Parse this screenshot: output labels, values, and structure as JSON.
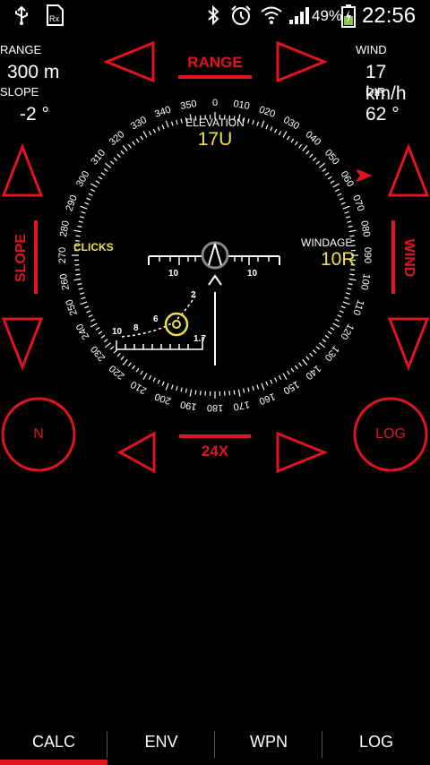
{
  "status_bar": {
    "battery": "49%",
    "time": "22:56"
  },
  "hud": {
    "range": {
      "label": "RANGE",
      "value": "300 m"
    },
    "slope": {
      "label": "SLOPE",
      "value": "-2 °"
    },
    "wind": {
      "label": "WIND",
      "value": "17 km/h"
    },
    "dir": {
      "label": "DIR",
      "value": "62 °"
    },
    "range_control": "RANGE",
    "slope_control": "SLOPE",
    "wind_control": "WIND",
    "zoom": "24X",
    "n_button": "N",
    "log_button": "LOG"
  },
  "scope": {
    "elevation_label": "ELEVATION",
    "elevation_value": "17U",
    "windage_label": "WINDAGE",
    "windage_value": "10R",
    "clicks_label": "CLICKS",
    "reticle_left_label": "10",
    "reticle_right_label": "10",
    "drop_labels": [
      "10",
      "8",
      "6",
      "2",
      "1.7"
    ]
  },
  "dial_labels": [
    "0",
    "010",
    "020",
    "030",
    "040",
    "050",
    "060",
    "070",
    "080",
    "090",
    "100",
    "110",
    "120",
    "130",
    "140",
    "150",
    "160",
    "170",
    "180",
    "190",
    "200",
    "210",
    "220",
    "230",
    "240",
    "250",
    "260",
    "270",
    "280",
    "290",
    "300",
    "310",
    "320",
    "330",
    "340",
    "350"
  ],
  "tabs": [
    "CALC",
    "ENV",
    "WPN",
    "LOG"
  ],
  "colors": {
    "accent": "#e0141e",
    "text": "#ffffff",
    "highlight": "#f0e04a"
  }
}
